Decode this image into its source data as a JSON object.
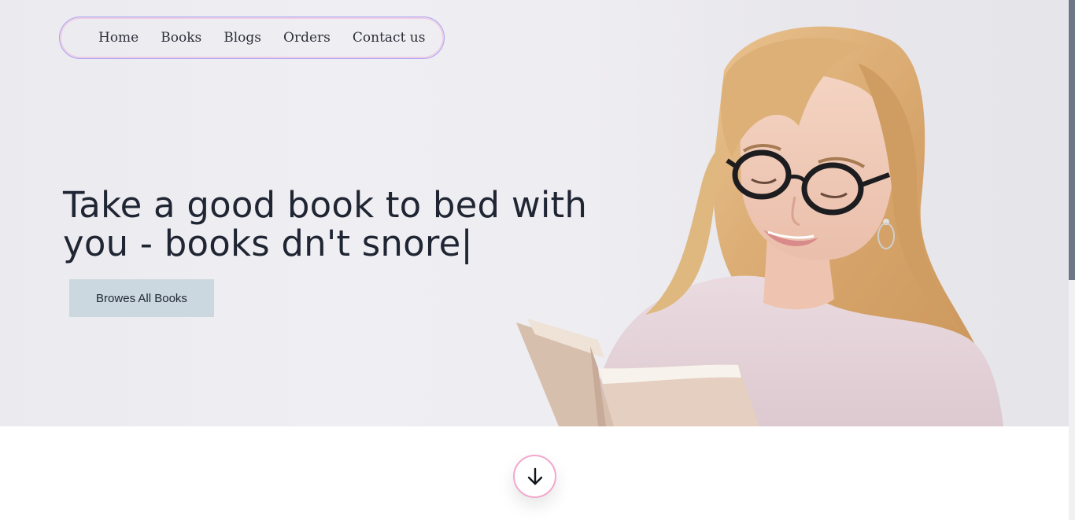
{
  "nav": {
    "items": [
      {
        "label": "Home"
      },
      {
        "label": "Books"
      },
      {
        "label": "Blogs"
      },
      {
        "label": "Orders"
      },
      {
        "label": "Contact us"
      }
    ]
  },
  "hero": {
    "headline": "Take a good book to bed with you - books dn't snore|",
    "browse_button": "Browes All Books"
  },
  "icons": {
    "scroll_down": "arrow-down-icon"
  },
  "colors": {
    "nav_border": "#a9a6f2",
    "button_bg": "#cbd8df",
    "headline": "#1f2533",
    "scroll_ring": "#f2a8cc"
  }
}
